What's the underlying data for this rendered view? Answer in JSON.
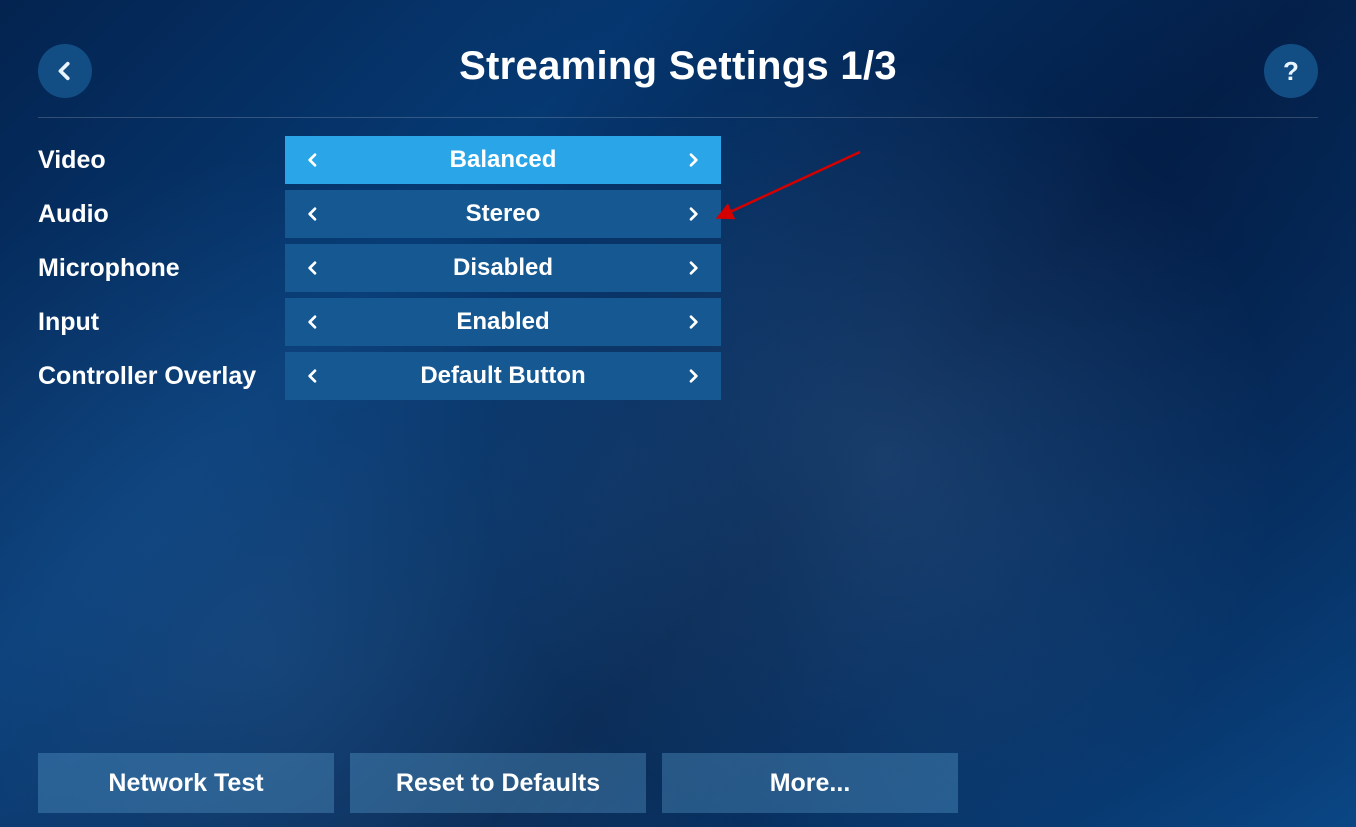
{
  "header": {
    "title": "Streaming Settings 1/3",
    "help_glyph": "?"
  },
  "settings": [
    {
      "label": "Video",
      "value": "Balanced",
      "selected": true
    },
    {
      "label": "Audio",
      "value": "Stereo",
      "selected": false
    },
    {
      "label": "Microphone",
      "value": "Disabled",
      "selected": false
    },
    {
      "label": "Input",
      "value": "Enabled",
      "selected": false
    },
    {
      "label": "Controller Overlay",
      "value": "Default Button",
      "selected": false
    }
  ],
  "footer": {
    "network_test": "Network Test",
    "reset": "Reset to Defaults",
    "more": "More..."
  },
  "annotation": {
    "kind": "red-arrow",
    "description": "Red arrow pointing at the Audio picker's right chevron"
  }
}
